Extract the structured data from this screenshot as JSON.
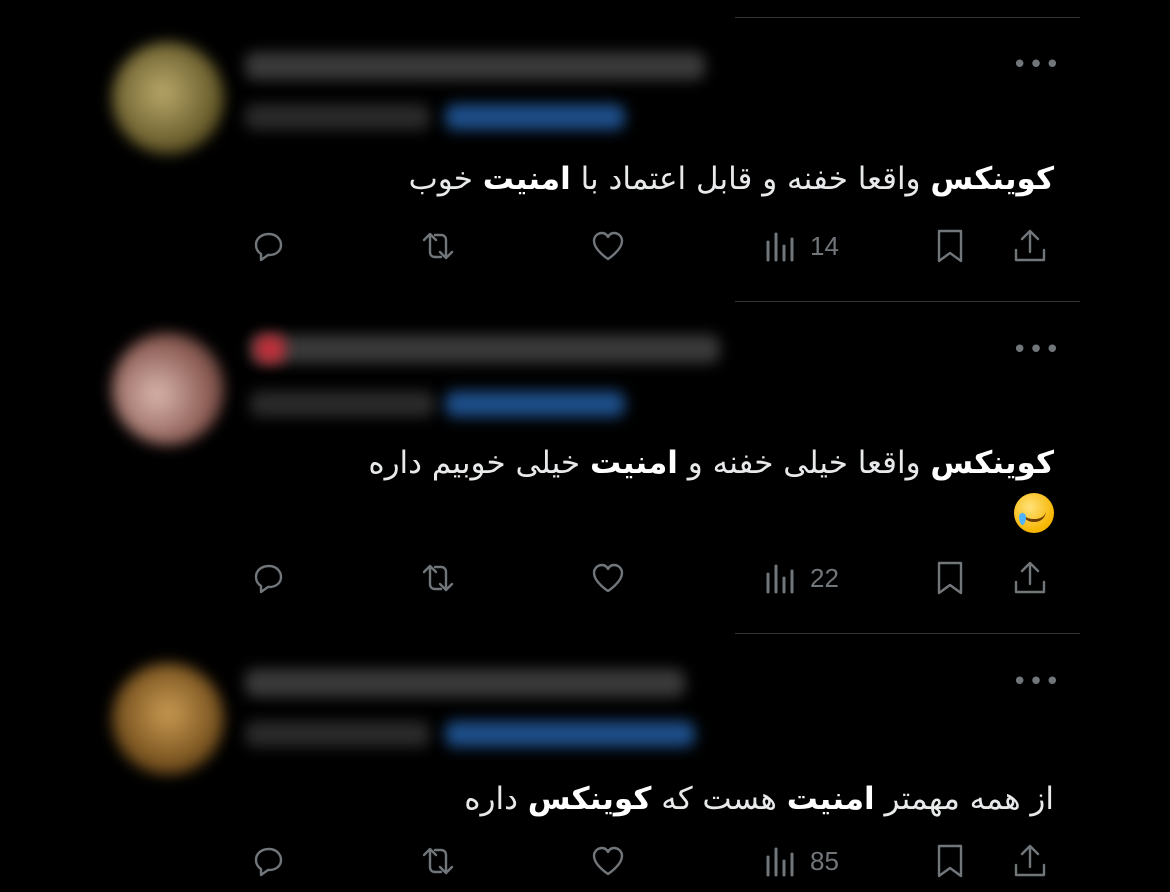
{
  "tweets": [
    {
      "text_parts": [
        {
          "t": "کوینکس",
          "b": true
        },
        {
          "t": " واقعا خفنه و قابل اعتماد با ",
          "b": false
        },
        {
          "t": "امنیت",
          "b": true
        },
        {
          "t": " خوب",
          "b": false
        }
      ],
      "views": "14",
      "more": "•••",
      "emoji": false
    },
    {
      "text_parts": [
        {
          "t": "کوینکس",
          "b": true
        },
        {
          "t": " واقعا خیلی خفنه و ",
          "b": false
        },
        {
          "t": "امنیت",
          "b": true
        },
        {
          "t": " خیلی خوبیم داره",
          "b": false
        }
      ],
      "views": "22",
      "more": "•••",
      "emoji": true
    },
    {
      "text_parts": [
        {
          "t": "از همه مهمتر ",
          "b": false
        },
        {
          "t": "امنیت",
          "b": true
        },
        {
          "t": " هست که ",
          "b": false
        },
        {
          "t": "کوینکس",
          "b": true
        },
        {
          "t": " داره",
          "b": false
        }
      ],
      "views": "85",
      "more": "•••",
      "emoji": false
    }
  ],
  "colors": {
    "background": "#000000",
    "text": "#e7e9ea",
    "muted": "#71767b",
    "link_blur": "#1d4e89",
    "divider": "#2f3336"
  },
  "icons": [
    "reply-icon",
    "retweet-icon",
    "like-icon",
    "views-icon",
    "bookmark-icon",
    "share-icon",
    "more-icon",
    "crying-smile-emoji"
  ]
}
